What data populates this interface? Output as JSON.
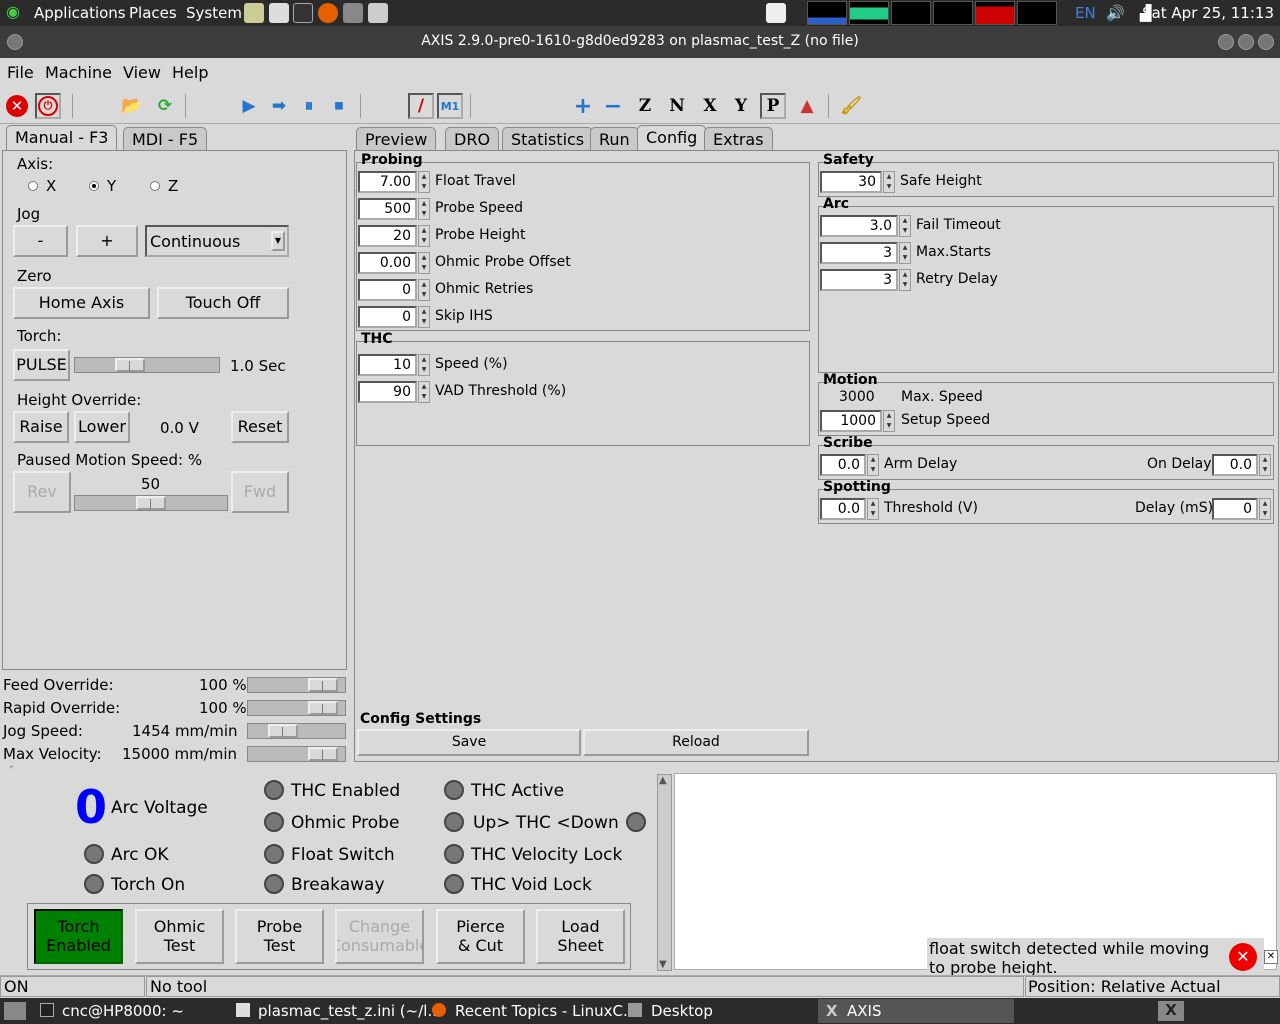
{
  "system": {
    "menus": [
      "Applications",
      "Places",
      "System"
    ],
    "lang": "EN",
    "clock": "Sat Apr 25, 11:13"
  },
  "window": {
    "title": "AXIS 2.9.0-pre0-1610-g8d0ed9283 on plasmac_test_Z (no file)"
  },
  "menubar": [
    "File",
    "Machine",
    "View",
    "Help"
  ],
  "left_tabs": [
    "Manual - F3",
    "MDI - F5"
  ],
  "manual": {
    "axis_label": "Axis:",
    "axes": [
      "X",
      "Y",
      "Z"
    ],
    "selected_axis": "Y",
    "jog_label": "Jog",
    "jog_minus": "-",
    "jog_plus": "+",
    "jog_mode": "Continuous",
    "zero_label": "Zero",
    "home_axis": "Home Axis",
    "touch_off": "Touch Off",
    "torch_label": "Torch:",
    "pulse": "PULSE",
    "pulse_time": "1.0 Sec",
    "height_label": "Height Override:",
    "raise": "Raise",
    "lower": "Lower",
    "height_value": "0.0 V",
    "reset": "Reset",
    "paused_label": "Paused Motion Speed: %",
    "rev": "Rev",
    "fwd": "Fwd",
    "paused_value": "50",
    "paused_fraction": 0.5,
    "pulse_fraction": 0.35
  },
  "overrides": [
    {
      "label": "Feed Override:",
      "value": "100 %",
      "fraction": 0.9
    },
    {
      "label": "Rapid Override:",
      "value": "100 %",
      "fraction": 0.9
    },
    {
      "label": "Jog Speed:",
      "value": "1454 mm/min",
      "fraction": 0.3
    },
    {
      "label": "Max Velocity:",
      "value": "15000 mm/min",
      "fraction": 0.9
    }
  ],
  "right_tabs": [
    "Preview",
    "DRO",
    "Statistics",
    "Run",
    "Config",
    "Extras"
  ],
  "selected_right_tab": "Config",
  "probing": {
    "title": "Probing",
    "rows": [
      {
        "value": "7.00",
        "label": "Float Travel"
      },
      {
        "value": "500",
        "label": "Probe Speed"
      },
      {
        "value": "20",
        "label": "Probe Height"
      },
      {
        "value": "0.00",
        "label": "Ohmic Probe Offset"
      },
      {
        "value": "0",
        "label": "Ohmic Retries"
      },
      {
        "value": "0",
        "label": "Skip IHS"
      }
    ]
  },
  "thc": {
    "title": "THC",
    "rows": [
      {
        "value": "10",
        "label": "Speed (%)"
      },
      {
        "value": "90",
        "label": "VAD Threshold (%)"
      }
    ]
  },
  "config_settings": {
    "title": "Config Settings",
    "save": "Save",
    "reload": "Reload"
  },
  "safety": {
    "title": "Safety",
    "rows": [
      {
        "value": "30",
        "label": "Safe Height"
      }
    ]
  },
  "arc": {
    "title": "Arc",
    "rows": [
      {
        "value": "3.0",
        "label": "Fail Timeout"
      },
      {
        "value": "3",
        "label": "Max.Starts"
      },
      {
        "value": "3",
        "label": "Retry Delay"
      }
    ]
  },
  "motion": {
    "title": "Motion",
    "max_speed_value": "3000",
    "max_speed_label": "Max. Speed",
    "setup_value": "1000",
    "setup_label": "Setup Speed"
  },
  "scribe": {
    "title": "Scribe",
    "arm_value": "0.0",
    "arm_label": "Arm Delay",
    "on_label": "On Delay",
    "on_value": "0.0"
  },
  "spotting": {
    "title": "Spotting",
    "thr_value": "0.0",
    "thr_label": "Threshold (V)",
    "delay_label": "Delay (mS)",
    "delay_value": "0"
  },
  "plasma": {
    "arc_voltage_value": "0",
    "arc_voltage_label": "Arc Voltage",
    "leds": [
      "Arc OK",
      "Torch On",
      "THC Enabled",
      "Ohmic Probe",
      "Float Switch",
      "Breakaway",
      "THC Active",
      "Up> THC <Down",
      "THC Velocity Lock",
      "THC Void Lock"
    ],
    "buttons": [
      {
        "label": "Torch\nEnabled",
        "active": true,
        "disabled": false
      },
      {
        "label": "Ohmic\nTest",
        "active": false,
        "disabled": false
      },
      {
        "label": "Probe\nTest",
        "active": false,
        "disabled": false
      },
      {
        "label": "Change\nConsumable",
        "active": false,
        "disabled": true
      },
      {
        "label": "Pierce\n& Cut",
        "active": false,
        "disabled": false
      },
      {
        "label": "Load\nSheet",
        "active": false,
        "disabled": false
      }
    ]
  },
  "notification": {
    "text": "float switch detected while moving to probe height."
  },
  "status": {
    "state": "ON",
    "tool": "No tool",
    "position": "Position: Relative Actual"
  },
  "taskbar": [
    "cnc@HP8000: ~",
    "plasmac_test_z.ini (~/l...",
    "Recent Topics - LinuxC...",
    "Desktop",
    "AXIS"
  ],
  "colors": {
    "torch_enabled": "#008000",
    "arc_voltage": "#0000ff",
    "led_off": "#777777"
  }
}
